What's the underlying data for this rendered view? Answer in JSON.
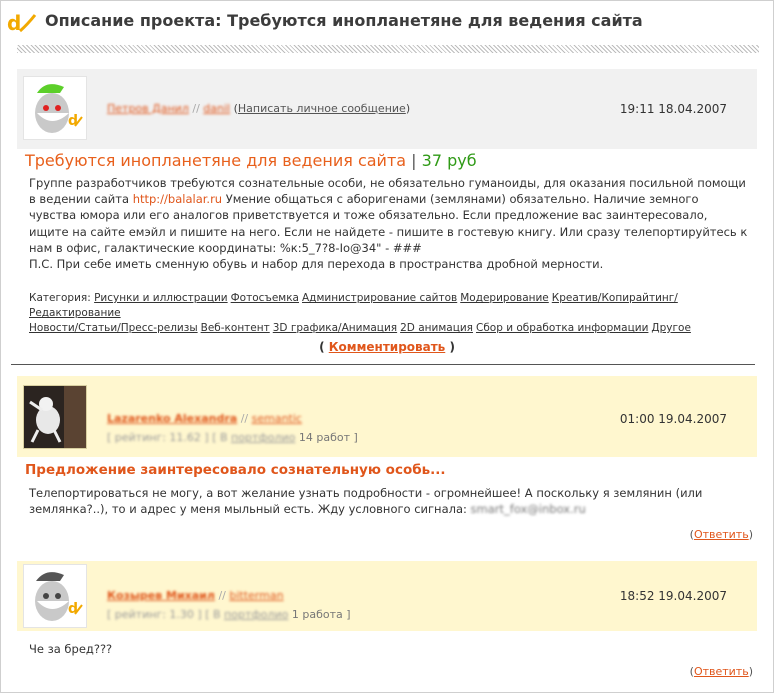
{
  "header": {
    "title": "Описание проекта: Требуются инопланетяне для ведения сайта"
  },
  "project": {
    "author": {
      "name": "Петров Данил",
      "login": "danil",
      "pm_link": "Написать личное сообщение"
    },
    "posted_at": "19:11 18.04.2007",
    "title": "Требуются инопланетяне для ведения сайта",
    "price": "37 руб",
    "description_before_link": "Группе разработчиков требуются сознательные особи, не обязательно гуманоиды, для оказания посильной помощи в ведении сайта ",
    "link": "http://balalar.ru",
    "description_after_link": " Умение общаться с аборигенами (землянами) обязательно. Наличие земного чувства юмора или его аналогов приветствуется и тоже обязательно. Если предложение вас заинтересовало, ищите на сайте емэйл и пишите на него. Если не найдете - пишите в гостевую книгу. Или сразу телепортируйтесь к нам в офис, галактические координаты: %к:5_7?8-Io@34\" - ###",
    "postscript": "П.С. При себе иметь сменную обувь и набор для перехода в пространства дробной мерности.",
    "categories_label": "Категория:",
    "categories": [
      "Рисунки и иллюстрации",
      "Фотосъемка",
      "Администрирование сайтов",
      "Модерирование",
      "Креатив/Копирайтинг/Редактирование",
      "Новости/Статьи/Пресс-релизы",
      "Веб-контент",
      "3D графика/Анимация",
      "2D анимация",
      "Сбор и обработка информации",
      "Другое"
    ],
    "comment_link": "Комментировать"
  },
  "comments": [
    {
      "author_name": "Lazarenko Alexandra",
      "author_login": "semantic",
      "meta_rating": "[ рейтинг: 11.62 ]",
      "meta_portfolio_pre": "[ В ",
      "meta_portfolio_link": "портфолио",
      "meta_portfolio_count": " 14 работ ]",
      "posted_at": "01:00 19.04.2007",
      "title": "Предложение заинтересовало сознательную особь...",
      "body": "Телепортироваться не могу, а вот желание узнать подробности - огромнейшее! А поскольку я землянин (или землянка?..), то и адрес у меня мыльный есть. Жду условного сигнала: ",
      "email": "smart_fox@inbox.ru",
      "reply_label": "Ответить"
    },
    {
      "author_name": "Козырев Михаил",
      "author_login": "bitterman",
      "meta_rating": "[ рейтинг: 1.30 ]",
      "meta_portfolio_pre": "[ В ",
      "meta_portfolio_link": "портфолио",
      "meta_portfolio_count": " 1 работа ]",
      "posted_at": "18:52 19.04.2007",
      "title": "",
      "body": "Че за бред???",
      "email": "",
      "reply_label": "Ответить"
    }
  ],
  "colors": {
    "accent": "#e0561b",
    "price": "#2f9a16",
    "comment_bg": "#fff7cf",
    "project_bg": "#f1f1f1"
  }
}
